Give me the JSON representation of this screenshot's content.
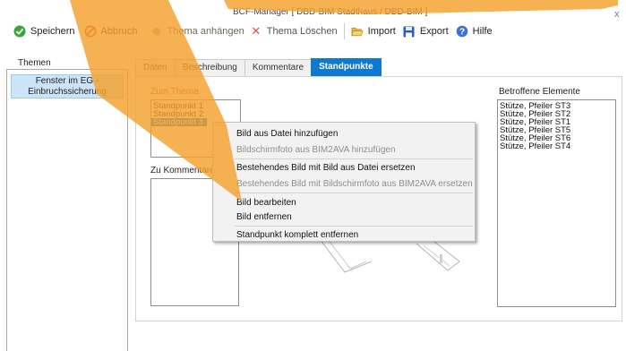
{
  "window": {
    "title": "BCF-Manager [ DBD-BIM Stadthaus / DBD-BIM ]",
    "close_glyph": "x"
  },
  "toolbar": {
    "save": "Speichern",
    "cancel": "Abbruch",
    "attach_topic": "Thema anhängen",
    "delete_topic": "Thema Löschen",
    "import": "Import",
    "export": "Export",
    "help": "Hilfe"
  },
  "themes": {
    "label": "Themen",
    "items": [
      "Fenster im EG - Einbruchssicherung"
    ]
  },
  "tabs": [
    {
      "label": "Daten",
      "active": false
    },
    {
      "label": "Beschreibung",
      "active": false
    },
    {
      "label": "Kommentare",
      "active": false
    },
    {
      "label": "Standpunkte",
      "active": true
    }
  ],
  "standpunkte": {
    "zum_thema_label": "Zum Thema",
    "viewpoints": [
      "Standpunkt 1",
      "Standpunkt 2",
      "Standpunkt 3"
    ],
    "selected_index": 2,
    "zu_kommentaren_label": "Zu Kommentaren",
    "betroffene_label": "Betroffene Elemente",
    "elements": [
      "Stütze, Pfeiler ST3",
      "Stütze, Pfeiler ST2",
      "Stütze, Pfeiler ST1",
      "Stütze, Pfeiler ST5",
      "Stütze, Pfeiler ST6",
      "Stütze, Pfeiler ST4"
    ]
  },
  "context_menu": {
    "items": [
      {
        "label": "Bild aus Datei hinzufügen",
        "enabled": true
      },
      {
        "label": "Bildschirmfoto aus BIM2AVA hinzufügen",
        "enabled": false
      },
      {
        "label": "Bestehendes Bild mit Bild aus Datei ersetzen",
        "enabled": true
      },
      {
        "label": "Bestehendes Bild mit Bildschirmfoto aus BIM2AVA ersetzen",
        "enabled": false
      },
      {
        "label": "Bild bearbeiten",
        "enabled": true
      },
      {
        "label": "Bild entfernen",
        "enabled": true
      },
      {
        "label": "Standpunkt komplett entfernen",
        "enabled": true
      }
    ]
  },
  "colors": {
    "accent": "#0f78d3",
    "highlight_arrow": "#f4a12c",
    "selection": "#0f6fcf"
  }
}
